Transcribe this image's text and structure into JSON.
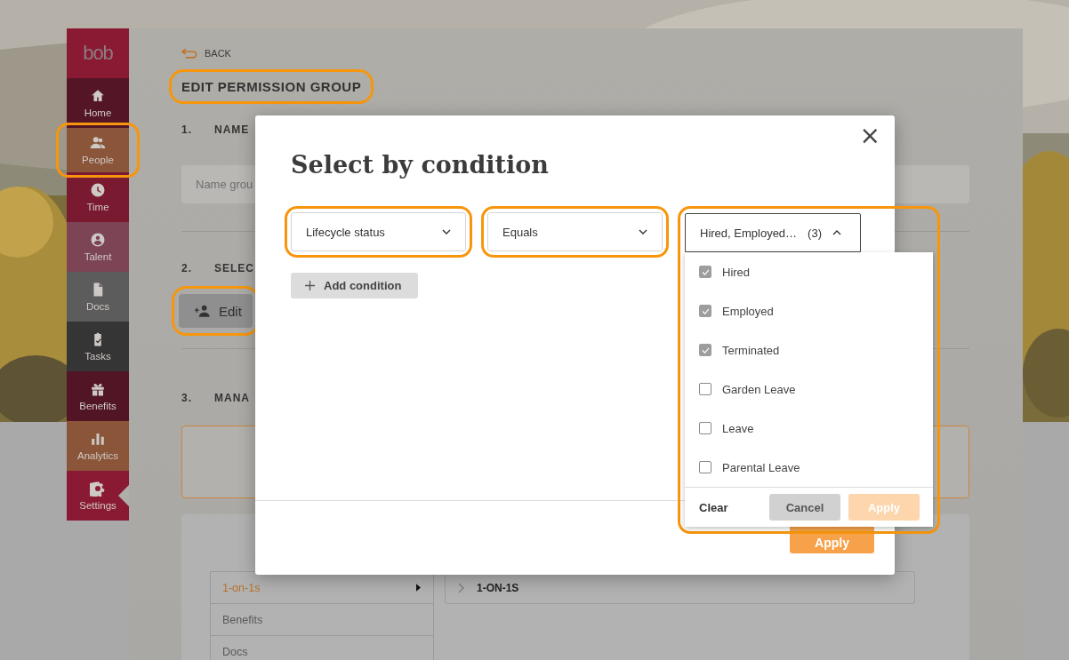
{
  "sidebar": {
    "logo": "bob",
    "items": [
      {
        "label": "Home",
        "color": "#541526",
        "selected": false,
        "highlighted": false
      },
      {
        "label": "People",
        "color": "#8a5538",
        "selected": false,
        "highlighted": true
      },
      {
        "label": "Time",
        "color": "#7a1a30",
        "selected": false,
        "highlighted": false
      },
      {
        "label": "Talent",
        "color": "#7d4455",
        "selected": false,
        "highlighted": false
      },
      {
        "label": "Docs",
        "color": "#5c5c5c",
        "selected": false,
        "highlighted": false
      },
      {
        "label": "Tasks",
        "color": "#353535",
        "selected": false,
        "highlighted": false
      },
      {
        "label": "Benefits",
        "color": "#521526",
        "selected": false,
        "highlighted": false
      },
      {
        "label": "Analytics",
        "color": "#8a5538",
        "selected": false,
        "highlighted": false
      },
      {
        "label": "Settings",
        "color": "#8a1a33",
        "selected": true,
        "highlighted": false
      }
    ]
  },
  "page": {
    "back_link": "BACK",
    "title": {
      "text": "EDIT PERMISSION GROUP",
      "highlighted": true
    },
    "sections": [
      {
        "number": "1.",
        "heading": "NAME"
      },
      {
        "number": "2.",
        "heading": "SELEC"
      },
      {
        "number": "3.",
        "heading": "MANA"
      }
    ],
    "name_field": {
      "placeholder": "Name grou"
    },
    "edit_button": {
      "label": "Edit",
      "highlighted": true
    },
    "permission_list": [
      {
        "label": "1-on-1s",
        "selected": true
      },
      {
        "label": "Benefits",
        "selected": false
      },
      {
        "label": "Docs",
        "selected": false
      }
    ],
    "detail_header": "1-ON-1S"
  },
  "modal": {
    "title": "Select by condition",
    "close": "×",
    "conditions": [
      {
        "value": "Lifecycle status",
        "highlighted": true
      },
      {
        "value": "Equals",
        "highlighted": true
      }
    ],
    "values": {
      "summary": "Hired, Employed…",
      "count": "(3)",
      "expanded": true,
      "highlighted": true,
      "options": [
        {
          "label": "Hired",
          "checked": true
        },
        {
          "label": "Employed",
          "checked": true
        },
        {
          "label": "Terminated",
          "checked": true
        },
        {
          "label": "Garden Leave",
          "checked": false
        },
        {
          "label": "Leave",
          "checked": false
        },
        {
          "label": "Parental Leave",
          "checked": false
        }
      ],
      "clear": "Clear",
      "cancel": "Cancel",
      "apply": {
        "label": "Apply",
        "disabled": true
      }
    },
    "add_condition": "Add condition",
    "apply": "Apply"
  }
}
